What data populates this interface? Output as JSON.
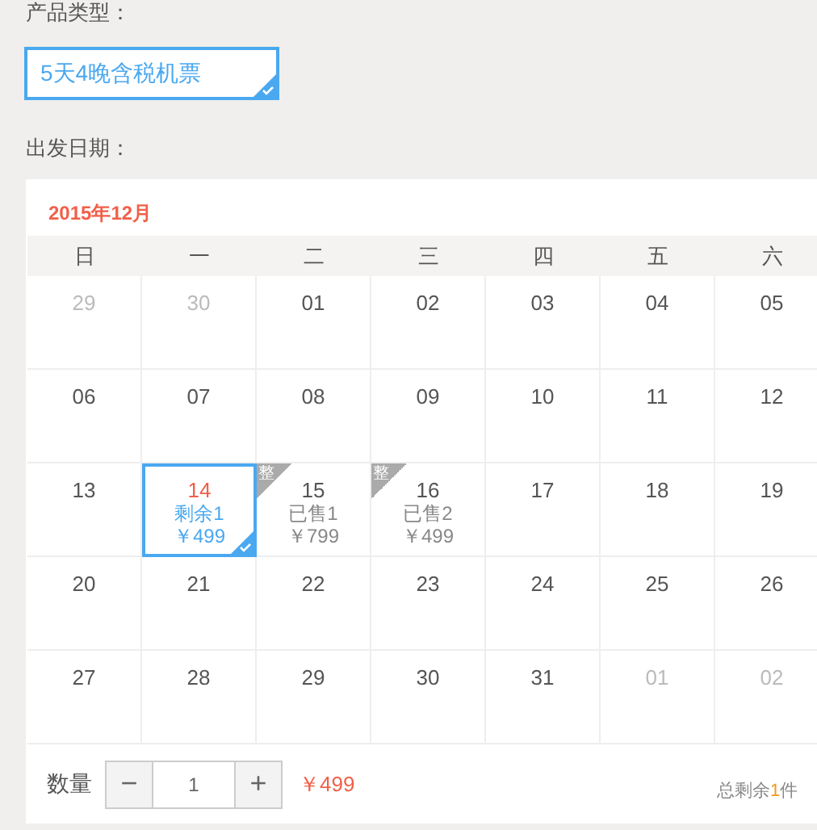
{
  "product_type": {
    "label": "产品类型：",
    "option": {
      "text": "5天4晚含税机票",
      "selected": true
    }
  },
  "departure": {
    "label": "出发日期："
  },
  "calendar": {
    "month": "2015年12月",
    "weekdays": [
      "日",
      "一",
      "二",
      "三",
      "四",
      "五",
      "六"
    ],
    "days": [
      {
        "date": "29",
        "muted": true,
        "selected": false
      },
      {
        "date": "30",
        "muted": true,
        "selected": false
      },
      {
        "date": "01",
        "muted": false,
        "selected": false
      },
      {
        "date": "02",
        "muted": false,
        "selected": false
      },
      {
        "date": "03",
        "muted": false,
        "selected": false
      },
      {
        "date": "04",
        "muted": false,
        "selected": false
      },
      {
        "date": "05",
        "muted": false,
        "selected": false
      },
      {
        "date": "06",
        "muted": false,
        "selected": false
      },
      {
        "date": "07",
        "muted": false,
        "selected": false
      },
      {
        "date": "08",
        "muted": false,
        "selected": false
      },
      {
        "date": "09",
        "muted": false,
        "selected": false
      },
      {
        "date": "10",
        "muted": false,
        "selected": false
      },
      {
        "date": "11",
        "muted": false,
        "selected": false
      },
      {
        "date": "12",
        "muted": false,
        "selected": false
      },
      {
        "date": "13",
        "muted": false,
        "selected": false
      },
      {
        "date": "14",
        "muted": false,
        "selected": true,
        "status": "剩余1",
        "price": "￥499"
      },
      {
        "date": "15",
        "muted": false,
        "selected": false,
        "tag": "整",
        "status": "已售1",
        "price": "￥799"
      },
      {
        "date": "16",
        "muted": false,
        "selected": false,
        "tag": "整",
        "status": "已售2",
        "price": "￥499"
      },
      {
        "date": "17",
        "muted": false,
        "selected": false
      },
      {
        "date": "18",
        "muted": false,
        "selected": false
      },
      {
        "date": "19",
        "muted": false,
        "selected": false
      },
      {
        "date": "20",
        "muted": false,
        "selected": false
      },
      {
        "date": "21",
        "muted": false,
        "selected": false
      },
      {
        "date": "22",
        "muted": false,
        "selected": false
      },
      {
        "date": "23",
        "muted": false,
        "selected": false
      },
      {
        "date": "24",
        "muted": false,
        "selected": false
      },
      {
        "date": "25",
        "muted": false,
        "selected": false
      },
      {
        "date": "26",
        "muted": false,
        "selected": false
      },
      {
        "date": "27",
        "muted": false,
        "selected": false
      },
      {
        "date": "28",
        "muted": false,
        "selected": false
      },
      {
        "date": "29",
        "muted": false,
        "selected": false
      },
      {
        "date": "30",
        "muted": false,
        "selected": false
      },
      {
        "date": "31",
        "muted": false,
        "selected": false
      },
      {
        "date": "01",
        "muted": true,
        "selected": false
      },
      {
        "date": "02",
        "muted": true,
        "selected": false
      }
    ]
  },
  "quantity": {
    "label": "数量",
    "minus": "−",
    "value": "1",
    "plus": "+",
    "price": "￥499"
  },
  "remaining": {
    "prefix": "总剩余",
    "count": "1",
    "suffix": "件"
  }
}
